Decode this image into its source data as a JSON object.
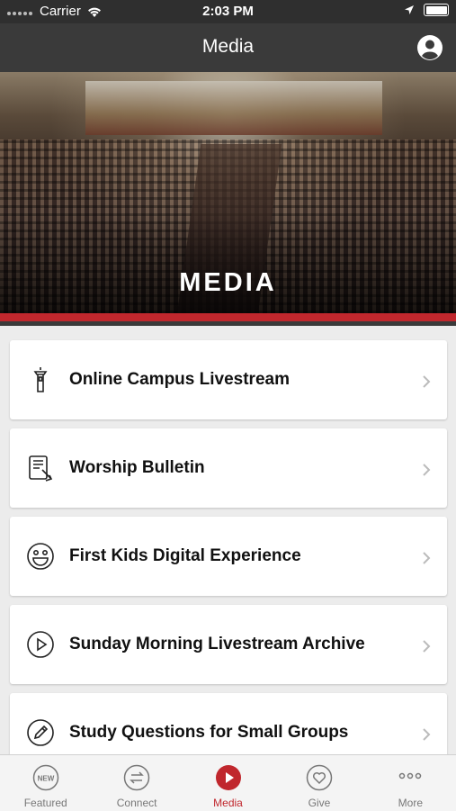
{
  "status_bar": {
    "carrier": "Carrier",
    "time": "2:03 PM"
  },
  "nav": {
    "title": "Media"
  },
  "hero": {
    "title": "MEDIA"
  },
  "menu": [
    {
      "label": "Online Campus Livestream",
      "icon": "tower-icon"
    },
    {
      "label": "Worship Bulletin",
      "icon": "bulletin-icon"
    },
    {
      "label": "First Kids Digital Experience",
      "icon": "smiley-icon"
    },
    {
      "label": "Sunday Morning Livestream Archive",
      "icon": "play-icon"
    },
    {
      "label": "Study Questions for Small Groups",
      "icon": "pencil-icon"
    }
  ],
  "tabs": [
    {
      "label": "Featured",
      "icon": "new-badge-icon",
      "badge": "NEW"
    },
    {
      "label": "Connect",
      "icon": "connect-arrows-icon"
    },
    {
      "label": "Media",
      "icon": "play-icon",
      "active": true
    },
    {
      "label": "Give",
      "icon": "heart-icon"
    },
    {
      "label": "More",
      "icon": "more-dots-icon"
    }
  ],
  "colors": {
    "accent": "#c0272d",
    "nav": "#3a3a3a",
    "status": "#2f2f2f"
  }
}
